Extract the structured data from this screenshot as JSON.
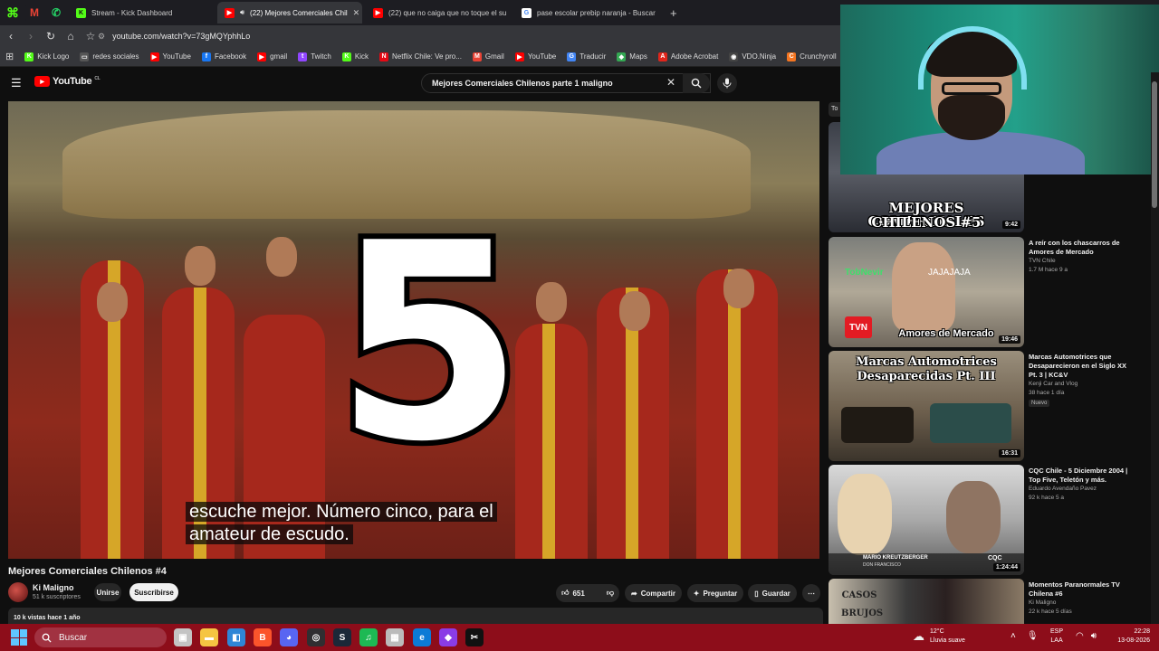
{
  "browser": {
    "pinned_tabs": [
      {
        "icon": "kick-icon",
        "label": "K",
        "color": "#53fc18"
      },
      {
        "icon": "gmail-icon",
        "label": "M",
        "color": "#ea4335"
      },
      {
        "icon": "whatsapp-icon",
        "label": "✆",
        "color": "#25d366"
      }
    ],
    "tabs": [
      {
        "title": "Stream - Kick Dashboard",
        "fav_label": "K",
        "fav_color": "#53fc18",
        "active": false
      },
      {
        "title": "(22) Mejores Comerciales Chil",
        "fav_label": "▶",
        "fav_color": "#ff0000",
        "active": true
      },
      {
        "title": "(22) que no caiga que no toque el su",
        "fav_label": "▶",
        "fav_color": "#ff0000",
        "active": false
      },
      {
        "title": "pase escolar prebip naranja - Buscar",
        "fav_label": "G",
        "fav_color": "#4285f4",
        "active": false
      }
    ],
    "new_tab_label": "+",
    "url": "youtube.com/watch?v=73gMQYphhLo",
    "bookmarks": [
      {
        "label": "Kick Logo",
        "icon_label": "K",
        "color": "#53fc18"
      },
      {
        "label": "redes sociales",
        "icon_label": "▭",
        "color": "#555555"
      },
      {
        "label": "YouTube",
        "icon_label": "▶",
        "color": "#ff0000"
      },
      {
        "label": "Facebook",
        "icon_label": "f",
        "color": "#1877f2"
      },
      {
        "label": "gmail",
        "icon_label": "▶",
        "color": "#ff0000"
      },
      {
        "label": "Twitch",
        "icon_label": "t",
        "color": "#9146ff"
      },
      {
        "label": "Kick",
        "icon_label": "K",
        "color": "#53fc18"
      },
      {
        "label": "Netflix Chile: Ve pro...",
        "icon_label": "N",
        "color": "#e50914"
      },
      {
        "label": "Gmail",
        "icon_label": "M",
        "color": "#ea4335"
      },
      {
        "label": "YouTube",
        "icon_label": "▶",
        "color": "#ff0000"
      },
      {
        "label": "Traducir",
        "icon_label": "G",
        "color": "#4285f4"
      },
      {
        "label": "Maps",
        "icon_label": "◆",
        "color": "#34a853"
      },
      {
        "label": "Adobe Acrobat",
        "icon_label": "A",
        "color": "#e1251b"
      },
      {
        "label": "VDO.Ninja",
        "icon_label": "◉",
        "color": "#444444"
      },
      {
        "label": "Crunchyroll",
        "icon_label": "C",
        "color": "#f47521"
      }
    ]
  },
  "youtube": {
    "logo_text": "YouTube",
    "logo_region": "CL",
    "search_query": "Mejores Comerciales Chilenos parte 1 maligno",
    "video": {
      "big_number": "5",
      "subtitle_line1": "escuche mejor. Número cinco, para el",
      "subtitle_line2": "amateur de escudo."
    },
    "title": "Mejores Comerciales Chilenos #4",
    "channel": "Ki Maligno",
    "subscribers": "51 k suscriptores",
    "join_label": "Unirse",
    "subscribe_label": "Suscribirse",
    "likes": "651",
    "share_label": "Compartir",
    "ask_label": "Preguntar",
    "save_label": "Guardar",
    "views_line": "10 k vistas  hace 1 año",
    "recommendations": [
      {
        "thumb_text_1": "MEJORES COMERCIALES",
        "thumb_text_2": "CHILENOS #5",
        "duration": "9:42",
        "title": "",
        "channel": "",
        "meta": ""
      },
      {
        "thumb_text_1": "Amores de Mercado",
        "overlay_chat_user": "TobNevir",
        "overlay_chat_msg": "JAJAJAJA",
        "logo_text": "TVN",
        "duration": "19:46",
        "title": "A reír con los chascarros de Amores de Mercado",
        "channel": "TVN Chile",
        "meta": "1.7 M  hace 9 a"
      },
      {
        "thumb_text_1": "Marcas Automotrices",
        "thumb_text_2": "Desaparecidas Pt. III",
        "duration": "16:31",
        "title": "Marcas Automotrices que Desaparecieron en el Siglo XX Pt. 3 | KC&V",
        "channel": "Kenji Car and Vlog",
        "meta": "38  hace 1 día",
        "badge": "Nuevo"
      },
      {
        "thumb_text_1": "MARIO KREUTZBERGER",
        "thumb_text_2": "DON FRANCISCO",
        "thumb_logo": "CQC",
        "duration": "1:24:44",
        "title": "CQC Chile - 5 Diciembre 2004 | Top Five, Teletón y más.",
        "channel": "Eduardo Avendaño Pavez",
        "meta": "92 k  hace 5 a"
      },
      {
        "thumb_text_1": "CASOS",
        "thumb_text_2": "BRUJOS",
        "duration": "",
        "title": "Momentos Paranormales TV Chilena #6",
        "channel": "Ki Maligno",
        "meta": "22 k  hace 5 días"
      }
    ]
  },
  "taskbar": {
    "search_placeholder": "Buscar",
    "weather_temp": "12°C",
    "weather_desc": "Lluvia suave",
    "lang_1": "ESP",
    "lang_2": "LAA",
    "time": "22:28",
    "date": "13-08-2026",
    "apps": [
      {
        "icon": "task-view-icon",
        "label": "▣",
        "color": "#c4c4c4"
      },
      {
        "icon": "file-explorer-icon",
        "label": "▬",
        "color": "#f5c542"
      },
      {
        "icon": "store-icon",
        "label": "◧",
        "color": "#2f86d6"
      },
      {
        "icon": "brave-icon",
        "label": "B",
        "color": "#fb542b"
      },
      {
        "icon": "discord-icon",
        "label": "◕",
        "color": "#5865f2"
      },
      {
        "icon": "obs-icon",
        "label": "◎",
        "color": "#302e31"
      },
      {
        "icon": "steam-icon",
        "label": "S",
        "color": "#1b2838"
      },
      {
        "icon": "spotify-icon",
        "label": "♫",
        "color": "#1db954"
      },
      {
        "icon": "app-icon",
        "label": "▦",
        "color": "#bbbbbb"
      },
      {
        "icon": "edge-icon",
        "label": "e",
        "color": "#0c7bd6"
      },
      {
        "icon": "vpn-icon",
        "label": "◆",
        "color": "#8a3ce6"
      },
      {
        "icon": "capcut-icon",
        "label": "✂",
        "color": "#111111"
      }
    ]
  }
}
